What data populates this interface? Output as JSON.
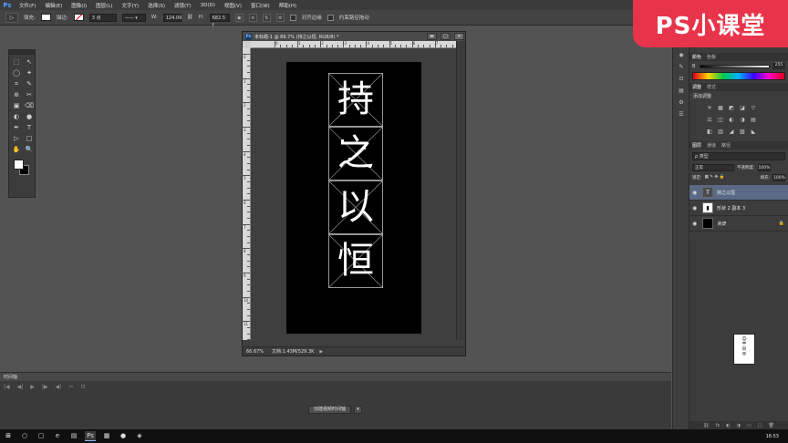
{
  "app": {
    "logo_text": "Ps",
    "menu": [
      "文件(F)",
      "编辑(E)",
      "图像(I)",
      "图层(L)",
      "文字(Y)",
      "选择(S)",
      "滤镜(T)",
      "3D(D)",
      "视图(V)",
      "窗口(W)",
      "帮助(H)"
    ]
  },
  "options": {
    "tool_glyph": "▷",
    "fill_label": "填充:",
    "stroke_label": "描边:",
    "stroke_width": "3 点",
    "w_label": "W:",
    "w_value": "124.09",
    "h_label": "H:",
    "h_value": "682.5 f",
    "align_edges_label": "对齐边缘",
    "constrain_path_label": "约束路径拖动"
  },
  "toolbox": {
    "tools": [
      "⬚",
      "↖",
      "◯",
      "✦",
      "⌗",
      "✎",
      "⊕",
      "✂",
      "▣",
      "⌫",
      "◐",
      "●",
      "✒",
      "T",
      "▷",
      "□",
      "✋",
      "🔍"
    ]
  },
  "document": {
    "title": "未标题-1 @ 66.7% (持之以恒, RGB/8) *",
    "ps_badge": "Ps",
    "controls": [
      "▬",
      "□",
      "✕"
    ],
    "ruler_h_labels": [
      "0",
      "1",
      "2",
      "3",
      "4",
      "5",
      "6",
      "7",
      "8"
    ],
    "ruler_v_labels": [
      "0",
      "1",
      "2",
      "3",
      "4",
      "5",
      "6",
      "7",
      "8",
      "9",
      "10",
      "11"
    ],
    "chars": [
      "持",
      "之",
      "以",
      "恒"
    ],
    "zoom": "66.67%",
    "doc_info": "文档:1.43M/529.3K",
    "status_arrow": "▶"
  },
  "timeline": {
    "tab_label": "时间轴",
    "controls": [
      "|◀",
      "◀|",
      "▶",
      "|▶",
      "◀)",
      "✂",
      "⊡"
    ],
    "create_button": "创建视频时间轴",
    "dropdown_glyph": "▾"
  },
  "right": {
    "color_tabs": [
      "颜色",
      "色板"
    ],
    "slider_label": "B",
    "slider_value": "255",
    "adjust_tabs": [
      "调整",
      "样式"
    ],
    "adjust_title": "添加调整",
    "adjust_icons": [
      "☀",
      "▦",
      "◩",
      "◪",
      "▽",
      "⚖",
      "◫",
      "◐",
      "◑",
      "▤",
      "◧",
      "▥",
      "◢",
      "▨",
      "◣"
    ],
    "layers_tabs": [
      "图层",
      "通道",
      "路径"
    ],
    "filter_label": "ρ 类型",
    "blend_mode": "正常",
    "opacity_label": "不透明度:",
    "opacity_value": "100%",
    "lock_label": "锁定:",
    "fill_label": "填充:",
    "fill_value": "100%",
    "layers": [
      {
        "name": "持之以恒",
        "thumb": "T",
        "type": "text",
        "selected": true
      },
      {
        "name": "形状 2 副本 3",
        "thumb": "▮",
        "type": "shape",
        "selected": false
      },
      {
        "name": "背景",
        "thumb": "",
        "type": "black",
        "selected": false
      }
    ],
    "bottom_icons": [
      "⛓",
      "fx",
      "◐",
      "◑",
      "▭",
      "▢",
      "🗑"
    ]
  },
  "icon_column": [
    "▶",
    "⊞",
    "◉",
    "✎",
    "⊡",
    "▤",
    "⚙",
    "☰"
  ],
  "watermark": {
    "text": "PS小课堂"
  },
  "mascot": {
    "text": "中\n同\n平"
  },
  "taskbar": {
    "icons": [
      "⊞",
      "○",
      "▢",
      "e",
      "▤",
      "Ps",
      "▦",
      "●",
      "◈"
    ],
    "time": "16:53"
  }
}
